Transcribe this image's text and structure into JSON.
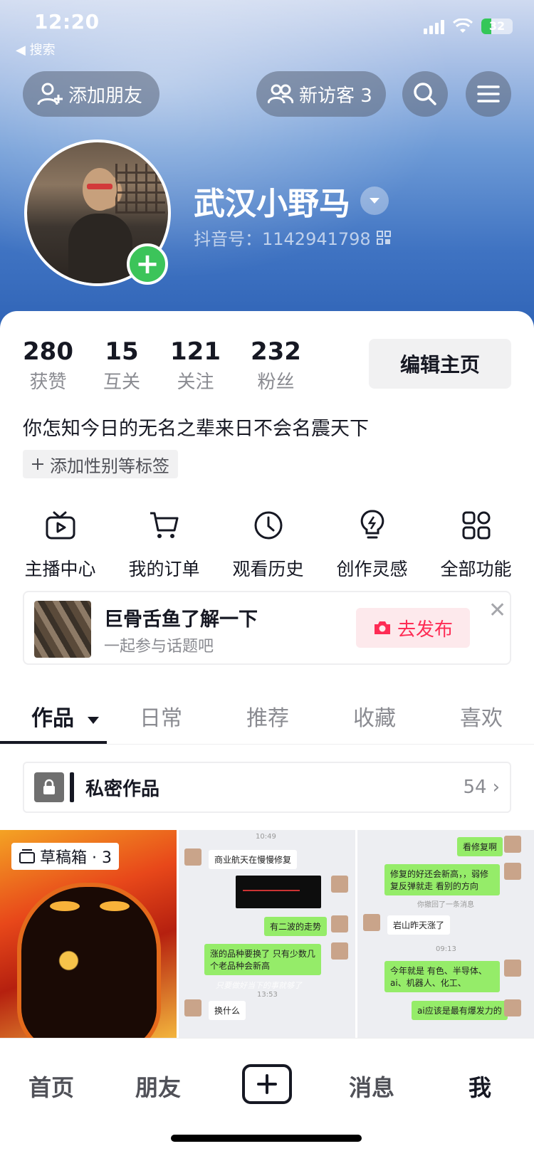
{
  "status_bar": {
    "time": "12:20",
    "back_label": "◀ 搜索",
    "battery": "32",
    "battery_level_pct": 32
  },
  "header": {
    "add_friend": "添加朋友",
    "new_visitors": "新访客 3",
    "search_icon": "search-icon",
    "menu_icon": "menu-icon"
  },
  "profile": {
    "nickname": "武汉小野马",
    "douyin_id": "抖音号：1142941798"
  },
  "stats": [
    {
      "value": "280",
      "label": "获赞"
    },
    {
      "value": "15",
      "label": "互关"
    },
    {
      "value": "121",
      "label": "关注"
    },
    {
      "value": "232",
      "label": "粉丝"
    }
  ],
  "edit_profile": "编辑主页",
  "bio": "你怎知今日的无名之辈来日不会名震天下",
  "add_tag": "添加性别等标签",
  "features": [
    {
      "label": "主播中心",
      "icon": "tv-icon"
    },
    {
      "label": "我的订单",
      "icon": "cart-icon"
    },
    {
      "label": "观看历史",
      "icon": "clock-icon"
    },
    {
      "label": "创作灵感",
      "icon": "lightbulb-icon"
    },
    {
      "label": "全部功能",
      "icon": "grid-icon"
    }
  ],
  "topic_card": {
    "title": "巨骨舌鱼了解一下",
    "subtitle": "一起参与话题吧",
    "publish": "去发布"
  },
  "tabs": [
    {
      "label": "作品"
    },
    {
      "label": "日常"
    },
    {
      "label": "推荐"
    },
    {
      "label": "收藏"
    },
    {
      "label": "喜欢"
    }
  ],
  "private_works": {
    "label": "私密作品",
    "count": "54"
  },
  "drafts_badge": "草稿箱 · 3",
  "chat_tile_1": {
    "time": "10:49",
    "msg1": "商业航天在慢慢修复",
    "msg2": "有二波的走势",
    "msg3": "涨的品种要换了 只有少数几个老品种会新高",
    "caption": "只要做好当下的事就够了",
    "time2": "13:53",
    "msg4": "换什么"
  },
  "chat_tile_2": {
    "msg1": "看修复啊",
    "msg2": "修复的好还会新高，，弱修复反弹就走 看别的方向",
    "recall": "你撤回了一条消息",
    "msg3": "岩山昨天涨了",
    "time": "09:13",
    "msg4": "今年就是 有色、半导体、ai、机器人、化工、",
    "msg5": "ai应该是最有爆发力的"
  },
  "bottom_nav": {
    "home": "首页",
    "friends": "朋友",
    "messages": "消息",
    "me": "我"
  }
}
